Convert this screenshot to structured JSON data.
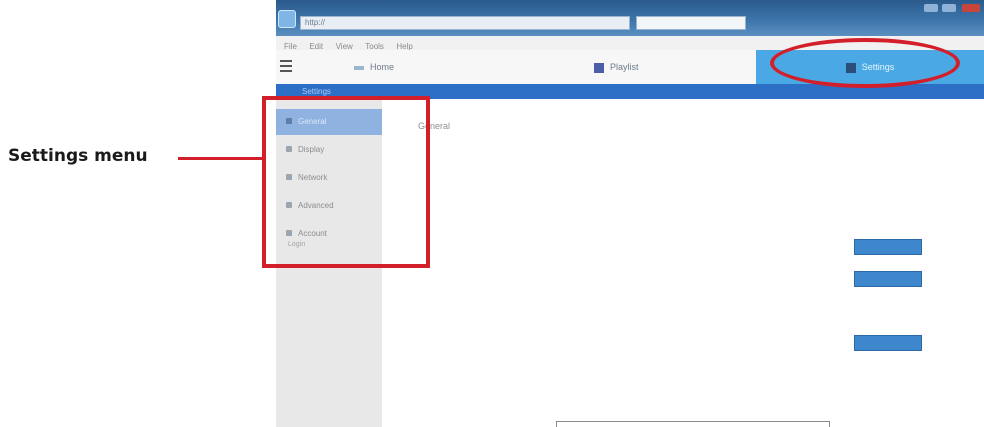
{
  "callout": {
    "settings_menu_label": "Settings menu"
  },
  "titlebar": {
    "address": "http://",
    "search_placeholder": ""
  },
  "menubar": {
    "items": [
      "File",
      "Edit",
      "View",
      "Tools",
      "Help"
    ]
  },
  "tabs": {
    "home": "Home",
    "playlist": "Playlist",
    "settings": "Settings"
  },
  "bluebar": {
    "text": "Settings"
  },
  "sidebar": {
    "items": [
      {
        "label": "General",
        "sub": ""
      },
      {
        "label": "Display",
        "sub": ""
      },
      {
        "label": "Network",
        "sub": ""
      },
      {
        "label": "Advanced",
        "sub": ""
      },
      {
        "label": "Account",
        "sub": "Login"
      }
    ]
  },
  "content": {
    "section_title": "General",
    "description": "",
    "groups": [
      {
        "label": "",
        "rows": [
          {
            "text": "",
            "button": ""
          },
          {
            "text": "",
            "button": ""
          }
        ]
      },
      {
        "label": "",
        "rows": [
          {
            "text": "",
            "button": ""
          }
        ]
      }
    ],
    "note": ""
  },
  "colors": {
    "accent": "#4aa9e4",
    "highlight": "#d21f2a",
    "bluebar": "#2d6fc7",
    "button": "#3f87cc"
  }
}
